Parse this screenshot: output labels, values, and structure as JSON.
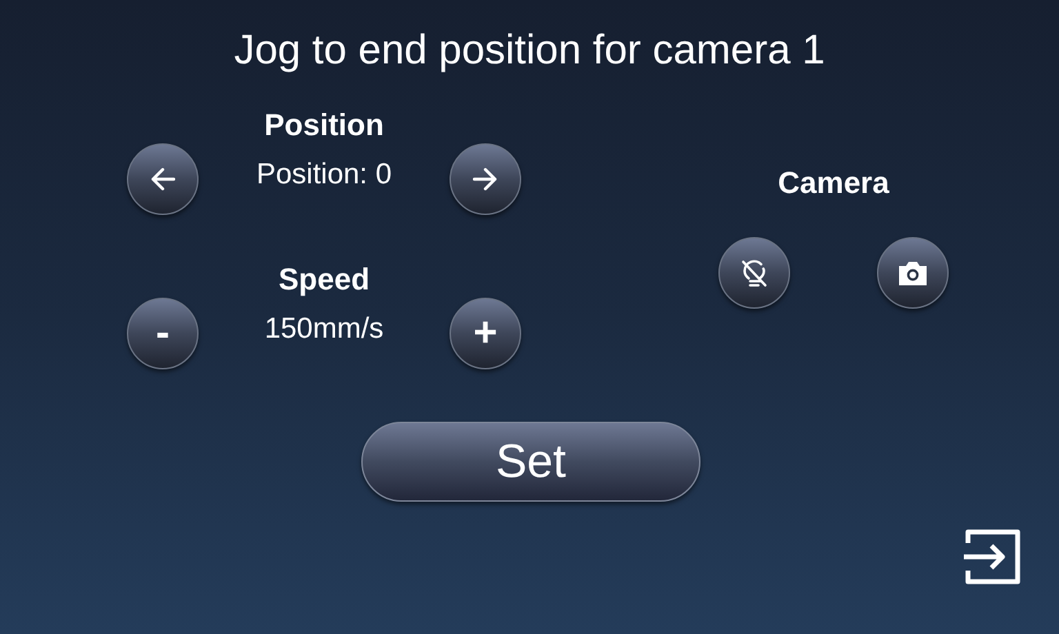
{
  "title": "Jog to end position for camera 1",
  "position": {
    "label": "Position",
    "value": "Position: 0"
  },
  "speed": {
    "label": "Speed",
    "value": "150mm/s",
    "decrease": "-",
    "increase": "+"
  },
  "camera": {
    "label": "Camera"
  },
  "set_button": "Set"
}
